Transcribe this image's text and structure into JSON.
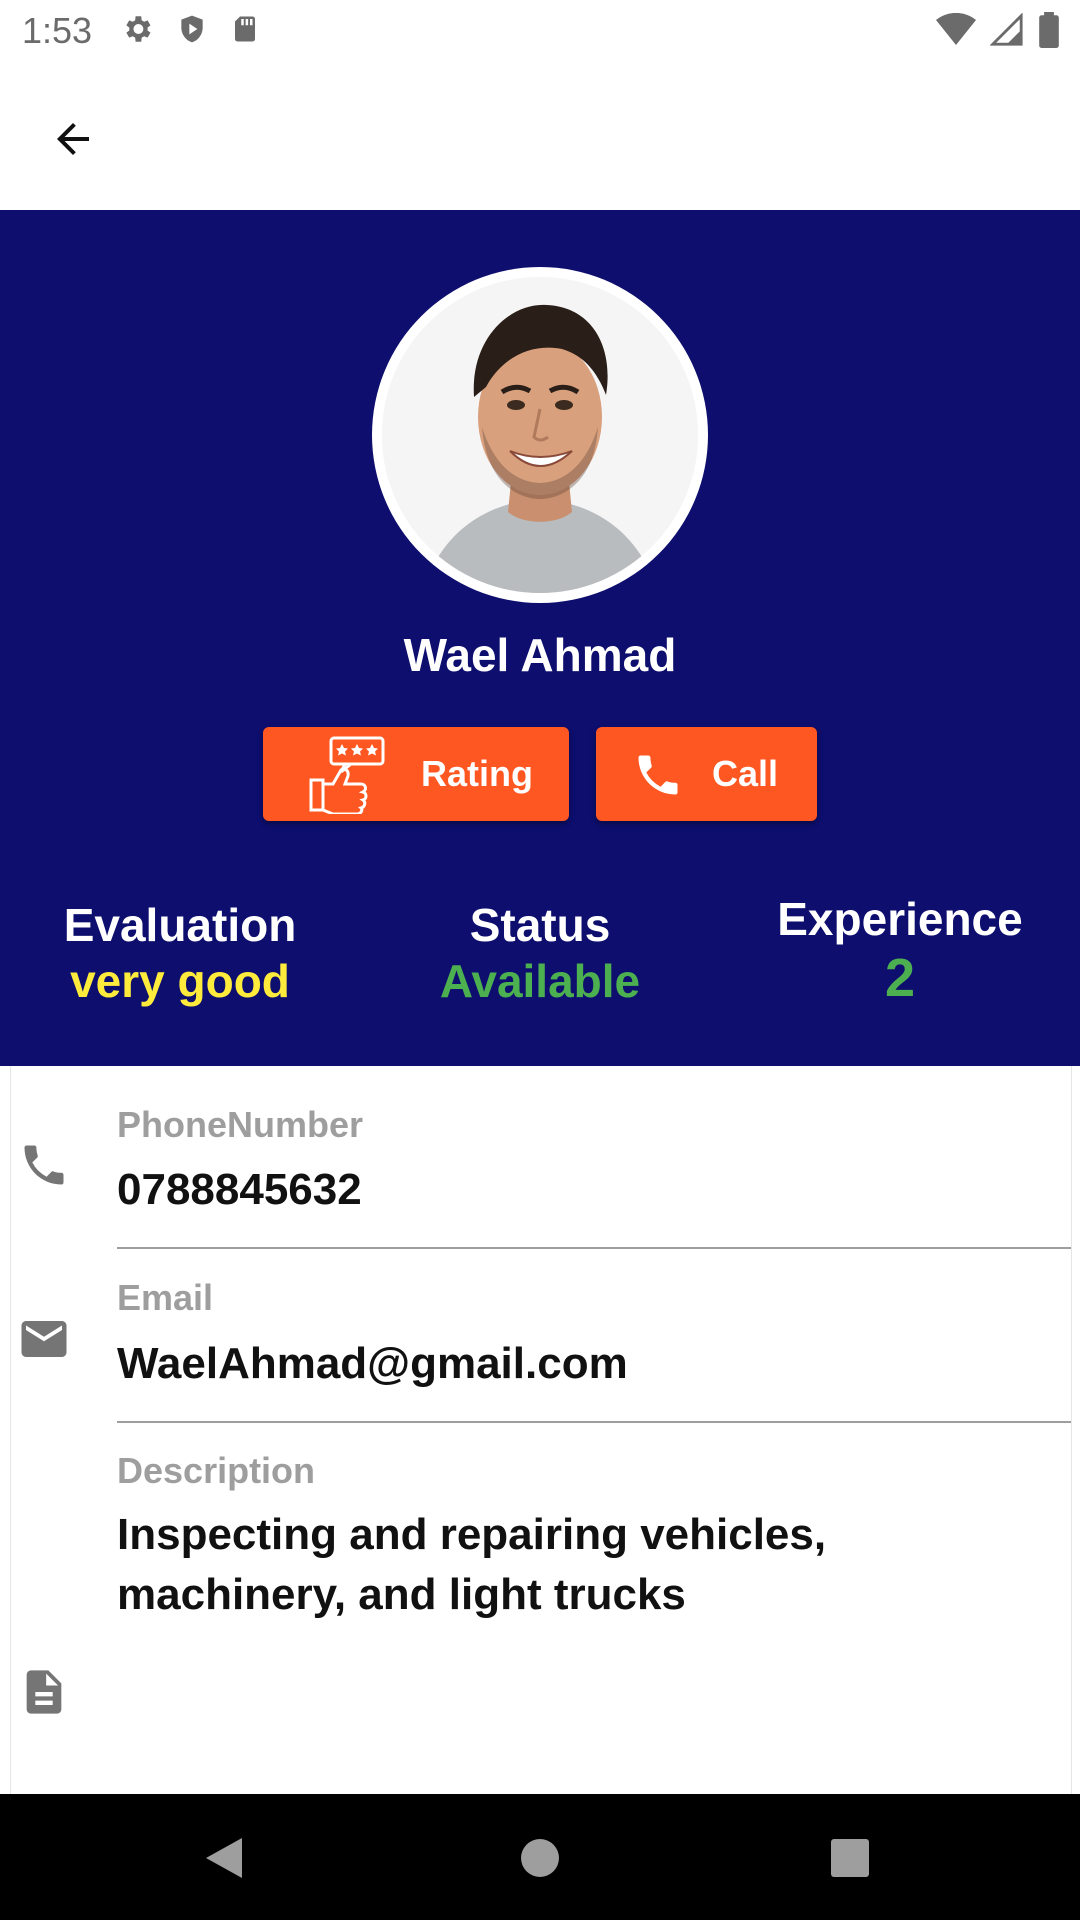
{
  "status_bar": {
    "time": "1:53",
    "left_icons": [
      "settings-icon",
      "shield-icon",
      "sd-card-icon"
    ],
    "right_icons": [
      "wifi-icon",
      "signal-icon",
      "battery-icon"
    ]
  },
  "app_bar": {
    "back_icon": "arrow-back-icon"
  },
  "profile": {
    "name": "Wael Ahmad",
    "buttons": {
      "rating_label": "Rating",
      "call_label": "Call"
    },
    "stats": {
      "evaluation": {
        "label": "Evaluation",
        "value": "very good"
      },
      "status": {
        "label": "Status",
        "value": "Available"
      },
      "experience": {
        "label": "Experience",
        "value": "2"
      }
    }
  },
  "details": {
    "phone": {
      "label": "PhoneNumber",
      "value": "0788845632"
    },
    "email": {
      "label": "Email",
      "value": "WaelAhmad@gmail.com"
    },
    "description": {
      "label": "Description",
      "value": "Inspecting and repairing vehicles, machinery, and light trucks"
    }
  },
  "colors": {
    "hero_bg": "#0d0e6e",
    "accent_orange": "#ff5722",
    "evaluation_yellow": "#ffeb3b",
    "status_green": "#4caf50"
  }
}
